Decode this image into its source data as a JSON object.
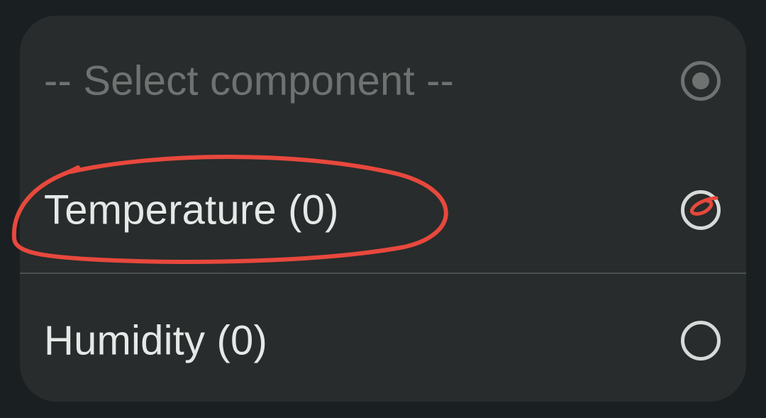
{
  "options": [
    {
      "label": "-- Select component --",
      "state": "disabled-selected"
    },
    {
      "label": "Temperature (0)",
      "state": "unselected"
    },
    {
      "label": "Humidity (0)",
      "state": "unselected"
    }
  ],
  "colors": {
    "page_background": "#1a1f22",
    "sheet_background": "#282c2c",
    "placeholder_text": "#6e7372",
    "option_text": "#e4e8e6",
    "annotation_stroke": "#e8483d"
  }
}
